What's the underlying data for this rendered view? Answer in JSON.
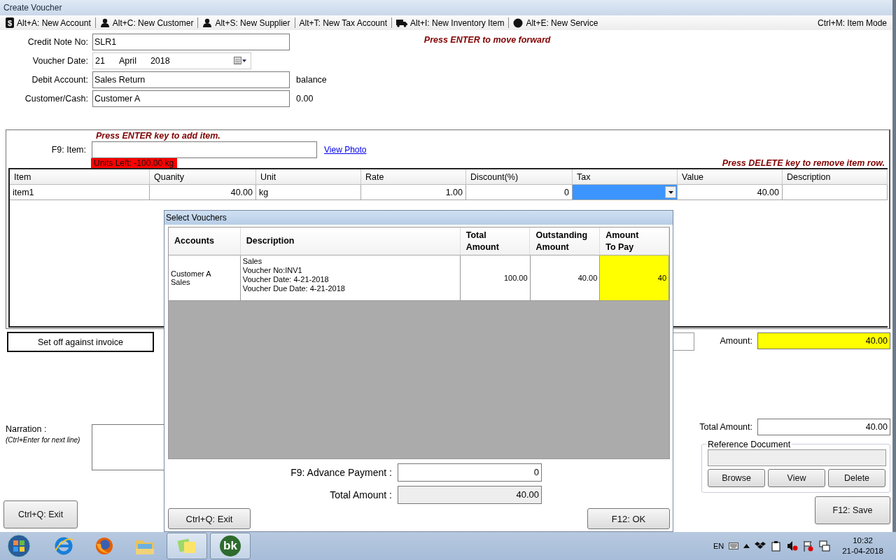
{
  "window": {
    "title": "Create Voucher"
  },
  "toolbar": {
    "items": [
      {
        "label": "Alt+A: New Account",
        "kind": "account",
        "glyph": "$"
      },
      {
        "label": "Alt+C: New Customer",
        "kind": "customer"
      },
      {
        "label": "Alt+S: New Supplier",
        "kind": "supplier"
      },
      {
        "label": "Alt+T: New Tax Account",
        "kind": "tax"
      },
      {
        "label": "Alt+I: New Inventory Item",
        "kind": "inventory"
      },
      {
        "label": "Alt+E: New Service",
        "kind": "service"
      }
    ],
    "right": "Ctrl+M: Item Mode"
  },
  "form": {
    "hint": "Press ENTER to move forward",
    "fields": [
      {
        "kind": "text",
        "label": "Credit Note No:",
        "value": "SLR1"
      },
      {
        "kind": "date",
        "label": "Voucher Date:",
        "day": "21",
        "month": "April",
        "year": "2018"
      },
      {
        "kind": "text",
        "label": "Debit Account:",
        "value": "Sales Return",
        "note": "balance"
      },
      {
        "kind": "text",
        "label": "Customer/Cash:",
        "value": "Customer A",
        "note": "0.00"
      }
    ]
  },
  "items": {
    "add_hint": "Press ENTER key to add item.",
    "item_label": "F9: Item:",
    "view_photo": "View Photo",
    "units_left": "Units Left:  -100.00 kg",
    "remove_hint": "Press DELETE key to remove item row.",
    "columns": [
      "Item",
      "Quanity",
      "Unit",
      "Rate",
      "Discount(%)",
      "Tax",
      "Value",
      "Description"
    ],
    "rows": [
      {
        "item": "item1",
        "quantity": "40.00",
        "unit": "kg",
        "rate": "1.00",
        "discount": "0",
        "tax_focused": true,
        "value": "40.00"
      }
    ]
  },
  "lower": {
    "set_off": "Set off against invoice",
    "amount_label": "Amount:",
    "amount": "40.00",
    "narration_label": "Narration :",
    "narration_hint": "(Ctrl+Enter for next line)",
    "total_label": "Total Amount:",
    "total": "40.00",
    "reference_legend": "Reference Document",
    "reference_buttons": [
      "Browse",
      "View",
      "Delete"
    ],
    "exit": "Ctrl+Q: Exit",
    "save": "F12: Save"
  },
  "dialog": {
    "title": "Select Vouchers",
    "columns": [
      "Accounts",
      "Description",
      "Total Amount",
      "Outstanding Amount",
      "Amount To Pay"
    ],
    "rows": [
      {
        "accounts": "Customer A\nSales",
        "description": "Sales\nVoucher No:INV1\nVoucher Date: 4-21-2018\nVoucher Due Date: 4-21-2018",
        "total": "100.00",
        "outstanding": "40.00",
        "to_pay": "40"
      }
    ],
    "advance_label": "F9: Advance Payment :",
    "advance": "0",
    "total_label": "Total Amount :",
    "total": "40.00",
    "exit": "Ctrl+Q: Exit",
    "ok": "F12: OK"
  },
  "taskbar": {
    "apps": [
      {
        "kind": "explorer-web",
        "active": false
      },
      {
        "kind": "firefox",
        "active": false
      },
      {
        "kind": "files",
        "active": false
      },
      {
        "kind": "notes",
        "active": true
      },
      {
        "kind": "bk",
        "active": true,
        "glyph": "bk"
      }
    ],
    "language": "EN",
    "time": "10:32",
    "date": "21-04-2018"
  }
}
